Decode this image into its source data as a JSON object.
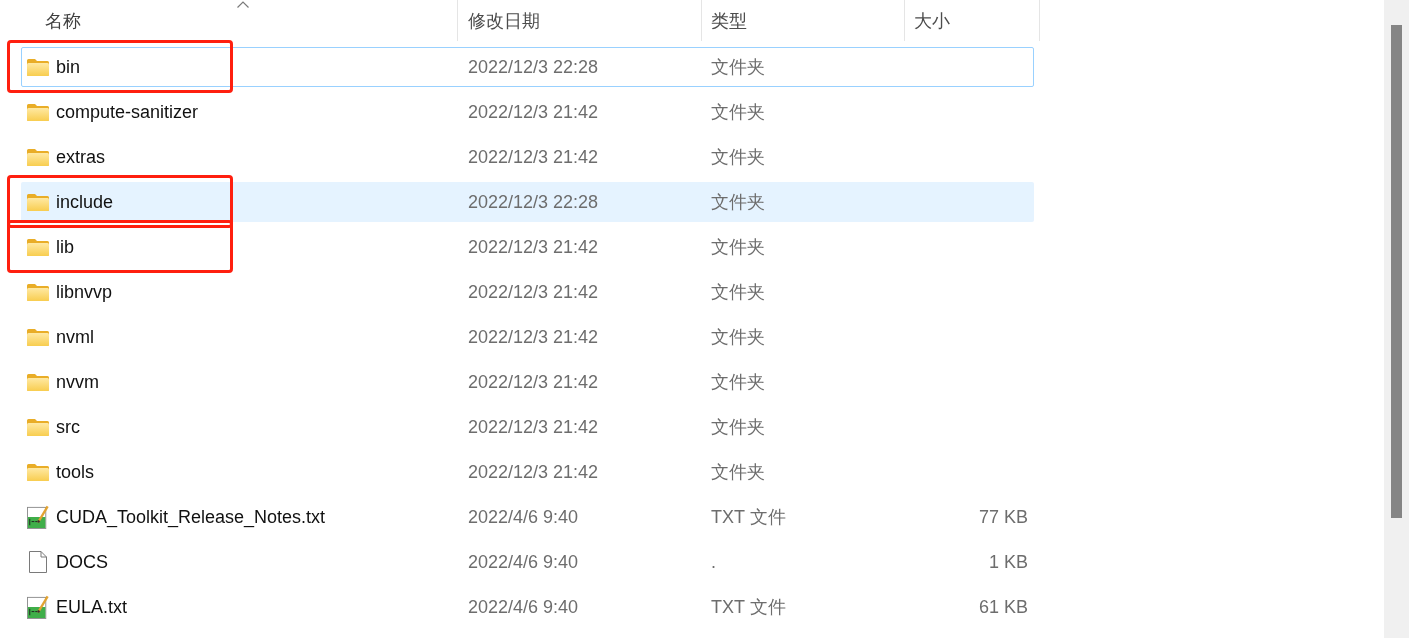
{
  "columns": [
    {
      "label": "名称",
      "sorted": true
    },
    {
      "label": "修改日期",
      "sorted": false
    },
    {
      "label": "类型",
      "sorted": false
    },
    {
      "label": "大小",
      "sorted": false
    }
  ],
  "rows": [
    {
      "kind": "folder",
      "name": "bin",
      "modified": "2022/12/3 22:28",
      "type": "文件夹",
      "selected": false,
      "focused": true,
      "annotated": true
    },
    {
      "kind": "folder",
      "name": "compute-sanitizer",
      "modified": "2022/12/3 21:42",
      "type": "文件夹",
      "selected": false,
      "focused": false,
      "annotated": false
    },
    {
      "kind": "folder",
      "name": "extras",
      "modified": "2022/12/3 21:42",
      "type": "文件夹",
      "selected": false,
      "focused": false,
      "annotated": false
    },
    {
      "kind": "folder",
      "name": "include",
      "modified": "2022/12/3 22:28",
      "type": "文件夹",
      "selected": true,
      "focused": false,
      "annotated": true
    },
    {
      "kind": "folder",
      "name": "lib",
      "modified": "2022/12/3 21:42",
      "type": "文件夹",
      "selected": false,
      "focused": false,
      "annotated": true
    },
    {
      "kind": "folder",
      "name": "libnvvp",
      "modified": "2022/12/3 21:42",
      "type": "文件夹",
      "selected": false,
      "focused": false,
      "annotated": false
    },
    {
      "kind": "folder",
      "name": "nvml",
      "modified": "2022/12/3 21:42",
      "type": "文件夹",
      "selected": false,
      "focused": false,
      "annotated": false
    },
    {
      "kind": "folder",
      "name": "nvvm",
      "modified": "2022/12/3 21:42",
      "type": "文件夹",
      "selected": false,
      "focused": false,
      "annotated": false
    },
    {
      "kind": "folder",
      "name": "src",
      "modified": "2022/12/3 21:42",
      "type": "文件夹",
      "selected": false,
      "focused": false,
      "annotated": false
    },
    {
      "kind": "folder",
      "name": "tools",
      "modified": "2022/12/3 21:42",
      "type": "文件夹",
      "selected": false,
      "focused": false,
      "annotated": false
    },
    {
      "kind": "text",
      "name": "CUDA_Toolkit_Release_Notes.txt",
      "modified": "2022/4/6 9:40",
      "type": "TXT 文件",
      "size": "77 KB",
      "selected": false,
      "focused": false,
      "annotated": false
    },
    {
      "kind": "file",
      "name": "DOCS",
      "modified": "2022/4/6 9:40",
      "type": ".",
      "size": "1 KB",
      "selected": false,
      "focused": false,
      "annotated": false
    },
    {
      "kind": "text",
      "name": "EULA.txt",
      "modified": "2022/4/6 9:40",
      "type": "TXT 文件",
      "size": "61 KB",
      "selected": false,
      "focused": false,
      "annotated": false
    }
  ]
}
